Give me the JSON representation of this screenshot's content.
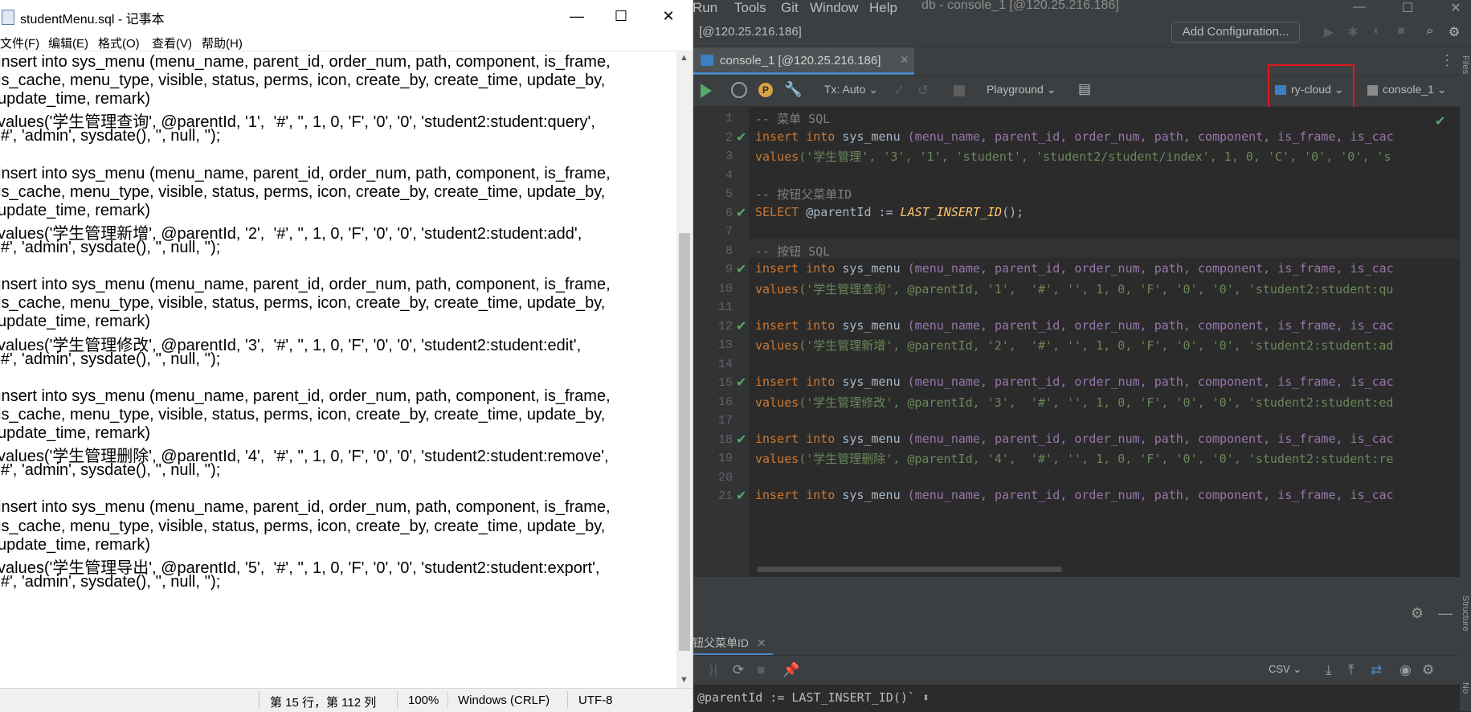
{
  "notepad": {
    "title": "studentMenu.sql - 记事本",
    "menu": [
      "文件(F)",
      "编辑(E)",
      "格式(O)",
      "查看(V)",
      "帮助(H)"
    ],
    "lines": [
      "insert into sys_menu (menu_name, parent_id, order_num, path, component, is_frame,",
      "is_cache, menu_type, visible, status, perms, icon, create_by, create_time, update_by,",
      "update_time, remark)",
      "values('学生管理查询', @parentId, '1',  '#', '', 1, 0, 'F', '0', '0', 'student2:student:query',",
      "'#', 'admin', sysdate(), '', null, '');",
      "",
      "insert into sys_menu (menu_name, parent_id, order_num, path, component, is_frame,",
      "is_cache, menu_type, visible, status, perms, icon, create_by, create_time, update_by,",
      "update_time, remark)",
      "values('学生管理新增', @parentId, '2',  '#', '', 1, 0, 'F', '0', '0', 'student2:student:add',",
      "'#', 'admin', sysdate(), '', null, '');",
      "",
      "insert into sys_menu (menu_name, parent_id, order_num, path, component, is_frame,",
      "is_cache, menu_type, visible, status, perms, icon, create_by, create_time, update_by,",
      "update_time, remark)",
      "values('学生管理修改', @parentId, '3',  '#', '', 1, 0, 'F', '0', '0', 'student2:student:edit',",
      "'#', 'admin', sysdate(), '', null, '');",
      "",
      "insert into sys_menu (menu_name, parent_id, order_num, path, component, is_frame,",
      "is_cache, menu_type, visible, status, perms, icon, create_by, create_time, update_by,",
      "update_time, remark)",
      "values('学生管理删除', @parentId, '4',  '#', '', 1, 0, 'F', '0', '0', 'student2:student:remove',",
      "'#', 'admin', sysdate(), '', null, '');",
      "",
      "insert into sys_menu (menu_name, parent_id, order_num, path, component, is_frame,",
      "is_cache, menu_type, visible, status, perms, icon, create_by, create_time, update_by,",
      "update_time, remark)",
      "values('学生管理导出', @parentId, '5',  '#', '', 1, 0, 'F', '0', '0', 'student2:student:export',",
      "'#', 'admin', sysdate(), '', null, '');"
    ],
    "status": {
      "position": "第 15 行，第 112 列",
      "zoom": "100%",
      "line_ending": "Windows (CRLF)",
      "encoding": "UTF-8"
    }
  },
  "ide": {
    "menu": [
      "Run",
      "Tools",
      "Git",
      "Window",
      "Help"
    ],
    "title": "db - console_1 [@120.25.216.186]",
    "breadcrumb": "[@120.25.216.186]",
    "add_configuration": "Add Configuration...",
    "tab_label": "console_1 [@120.25.216.186]",
    "toolbar": {
      "tx": "Tx: Auto",
      "playground": "Playground",
      "datasource": "ry-cloud",
      "console": "console_1"
    },
    "side_labels": {
      "files": "Files",
      "structure": "Structure",
      "notifications": "No"
    },
    "editor_lines": [
      {
        "n": "1",
        "ok": false
      },
      {
        "n": "2",
        "ok": true
      },
      {
        "n": "3",
        "ok": false
      },
      {
        "n": "4",
        "ok": false
      },
      {
        "n": "5",
        "ok": false
      },
      {
        "n": "6",
        "ok": true
      },
      {
        "n": "7",
        "ok": false
      },
      {
        "n": "8",
        "ok": false
      },
      {
        "n": "9",
        "ok": true
      },
      {
        "n": "10",
        "ok": false
      },
      {
        "n": "11",
        "ok": false
      },
      {
        "n": "12",
        "ok": true
      },
      {
        "n": "13",
        "ok": false
      },
      {
        "n": "14",
        "ok": false
      },
      {
        "n": "15",
        "ok": true
      },
      {
        "n": "16",
        "ok": false
      },
      {
        "n": "17",
        "ok": false
      },
      {
        "n": "18",
        "ok": true
      },
      {
        "n": "19",
        "ok": false
      },
      {
        "n": "20",
        "ok": false
      },
      {
        "n": "21",
        "ok": true
      }
    ],
    "code": {
      "comment_menu": "-- 菜单 SQL",
      "comment_parent": "-- 按钮父菜单ID",
      "comment_button": "-- 按钮 SQL",
      "insert_kw": "insert into",
      "table": "sys_menu",
      "cols": "(menu_name, parent_id, order_num, path, component, is_frame, is_cac",
      "values_kw": "values",
      "row3": "('学生管理', '3', '1', 'student', 'student2/student/index', 1, 0, 'C', '0', '0', 's",
      "select_kw": "SELECT",
      "var": "@parentId",
      "assign": ":=",
      "func": "LAST_INSERT_ID",
      "parens": "();",
      "row10": "('学生管理查询', @parentId, '1',  '#', '', 1, 0, 'F', '0', '0', 'student2:student:qu",
      "row13": "('学生管理新增', @parentId, '2',  '#', '', 1, 0, 'F', '0', '0', 'student2:student:ad",
      "row16": "('学生管理修改', @parentId, '3',  '#', '', 1, 0, 'F', '0', '0', 'student2:student:ed",
      "row19": "('学生管理删除', @parentId, '4',  '#', '', 1, 0, 'F', '0', '0', 'student2:student:re"
    },
    "services_tab": "钮父菜单ID",
    "export_format": "CSV",
    "statement": "@parentId := LAST_INSERT_ID()` ⬍"
  }
}
